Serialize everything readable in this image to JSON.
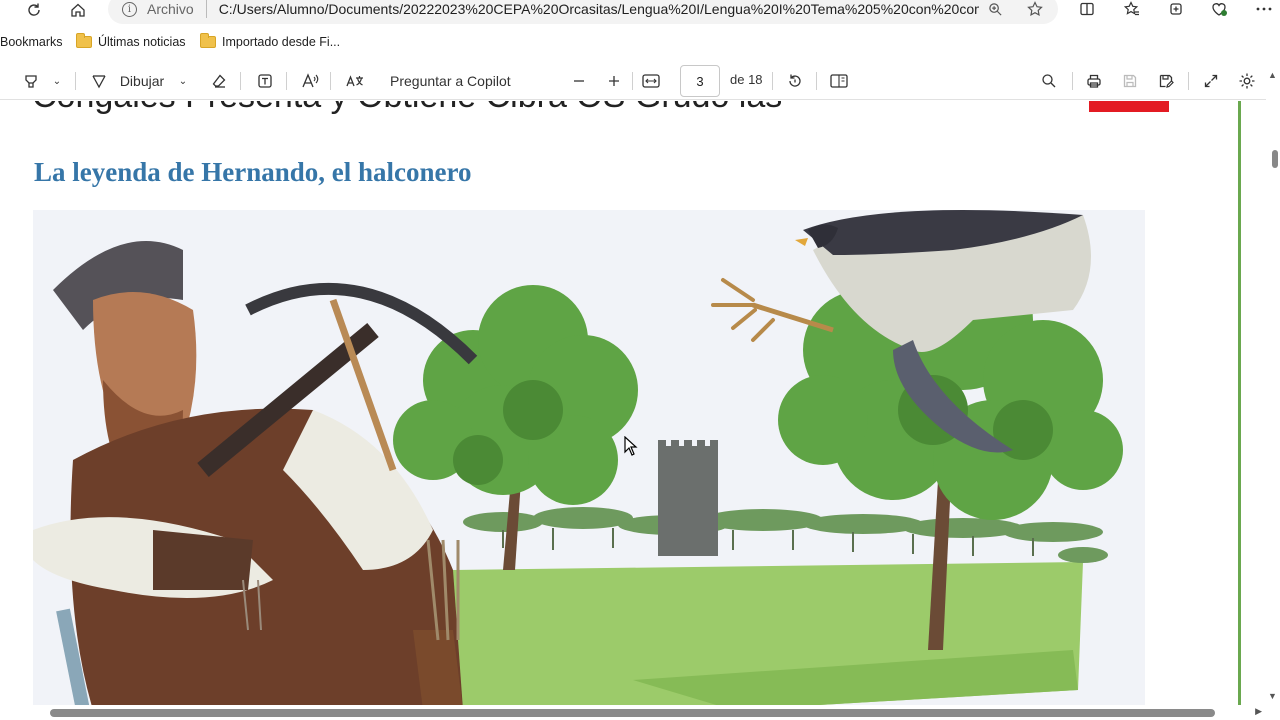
{
  "browser": {
    "address_scheme": "Archivo",
    "url": "C:/Users/Alumno/Documents/20222023%20CEPA%20Orcasitas/Lengua%20I/Lengua%20I%20Tema%205%20con%20com..."
  },
  "bookmarks": {
    "label": "Bookmarks",
    "items": [
      {
        "label": "Últimas noticias",
        "icon": "folder-icon"
      },
      {
        "label": "Importado desde Fi...",
        "icon": "folder-icon"
      }
    ]
  },
  "pdf_toolbar": {
    "draw_label": "Dibujar",
    "copilot_label": "Preguntar a Copilot",
    "page_current": "3",
    "page_total": "de 18"
  },
  "document": {
    "prev_line_text": "Cóngales  Presenta y Obtiene           Cibra                   OS  Grudo  las",
    "title": "La leyenda de Hernando, el halconero"
  },
  "colors": {
    "title": "#3676a8",
    "accent_red": "#e31b23",
    "page_edge": "#6aa84f"
  }
}
